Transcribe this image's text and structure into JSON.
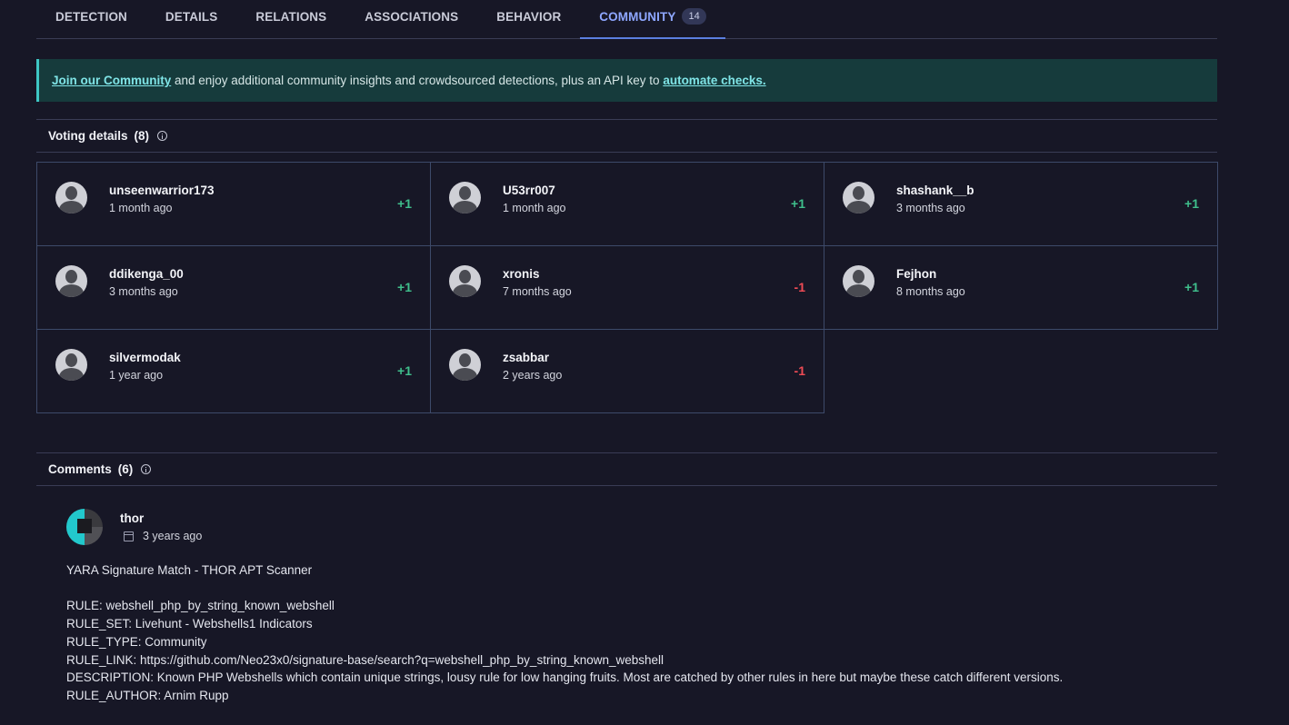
{
  "tabs": [
    {
      "label": "DETECTION"
    },
    {
      "label": "DETAILS"
    },
    {
      "label": "RELATIONS"
    },
    {
      "label": "ASSOCIATIONS"
    },
    {
      "label": "BEHAVIOR"
    },
    {
      "label": "COMMUNITY",
      "badge": "14",
      "active": true
    }
  ],
  "banner": {
    "link1": "Join our Community",
    "text1": " and enjoy additional community insights and crowdsourced detections, plus an API key to ",
    "link2": "automate checks."
  },
  "voting": {
    "title": "Voting details",
    "count": "(8)",
    "votes": [
      {
        "user": "unseenwarrior173",
        "time": "1 month ago",
        "score": "+1"
      },
      {
        "user": "U53rr007",
        "time": "1 month ago",
        "score": "+1"
      },
      {
        "user": "shashank__b",
        "time": "3 months ago",
        "score": "+1"
      },
      {
        "user": "ddikenga_00",
        "time": "3 months ago",
        "score": "+1"
      },
      {
        "user": "xronis",
        "time": "7 months ago",
        "score": "-1"
      },
      {
        "user": "Fejhon",
        "time": "8 months ago",
        "score": "+1"
      },
      {
        "user": "silvermodak",
        "time": "1 year ago",
        "score": "+1"
      },
      {
        "user": "zsabbar",
        "time": "2 years ago",
        "score": "-1"
      }
    ]
  },
  "comments": {
    "title": "Comments",
    "count": "(6)",
    "items": [
      {
        "user": "thor",
        "date": "3 years ago",
        "lines": [
          "YARA Signature Match - THOR APT Scanner",
          "",
          "RULE: webshell_php_by_string_known_webshell",
          "RULE_SET: Livehunt - Webshells1 Indicators",
          "RULE_TYPE: Community",
          "RULE_LINK: https://github.com/Neo23x0/signature-base/search?q=webshell_php_by_string_known_webshell",
          "DESCRIPTION: Known PHP Webshells which contain unique strings, lousy rule for low hanging fruits. Most are catched by other rules in here but maybe these catch different versions.",
          "RULE_AUTHOR: Arnim Rupp"
        ]
      }
    ]
  }
}
